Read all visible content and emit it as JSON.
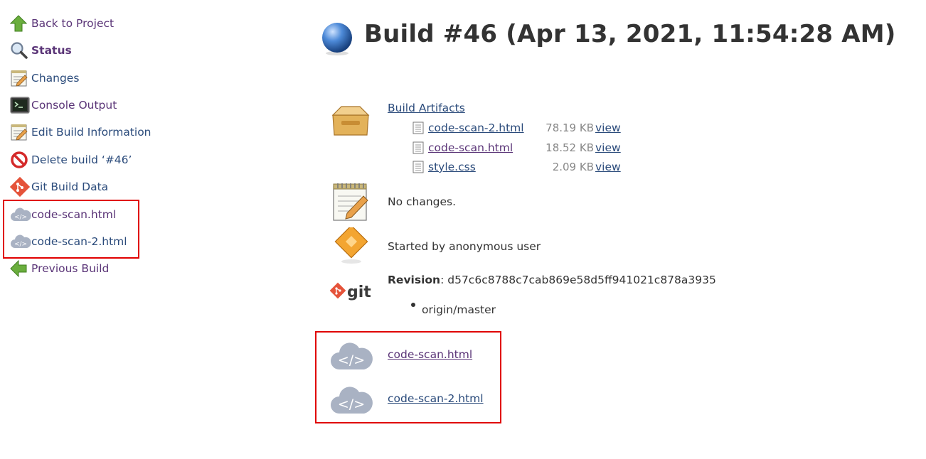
{
  "side_tasks": [
    {
      "label": "Back to Project",
      "icon": "up-arrow-icon"
    },
    {
      "label": "Status",
      "icon": "search-icon"
    },
    {
      "label": "Changes",
      "icon": "notepad-icon"
    },
    {
      "label": "Console Output",
      "icon": "terminal-icon"
    },
    {
      "label": "Edit Build Information",
      "icon": "notepad-icon"
    },
    {
      "label": "Delete build ‘#46’",
      "icon": "no-entry-icon"
    },
    {
      "label": "Git Build Data",
      "icon": "git-logo-icon"
    },
    {
      "label": "code-scan.html",
      "icon": "cloud-code-icon"
    },
    {
      "label": "code-scan-2.html",
      "icon": "cloud-code-icon"
    },
    {
      "label": "Previous Build",
      "icon": "left-arrow-icon"
    }
  ],
  "title": "Build #46 (Apr 13, 2021, 11:54:28 AM)",
  "artifacts": {
    "heading": "Build Artifacts",
    "files": [
      {
        "name": "code-scan-2.html",
        "size": "78.19 KB",
        "view": "view"
      },
      {
        "name": "code-scan.html",
        "size": "18.52 KB",
        "view": "view"
      },
      {
        "name": "style.css",
        "size": "2.09 KB",
        "view": "view"
      }
    ]
  },
  "changes_text": "No changes.",
  "cause_text": "Started by anonymous user",
  "revision": {
    "label": "Revision",
    "hash": ": d57c6c8788c7cab869e58d5ff941021c878a3935",
    "branch": "origin/master"
  },
  "reports": [
    {
      "label": "code-scan.html"
    },
    {
      "label": "code-scan-2.html"
    }
  ],
  "colors": {
    "link": "#2b4b7b",
    "visited": "#5a3477",
    "highlight": "#e00000"
  }
}
